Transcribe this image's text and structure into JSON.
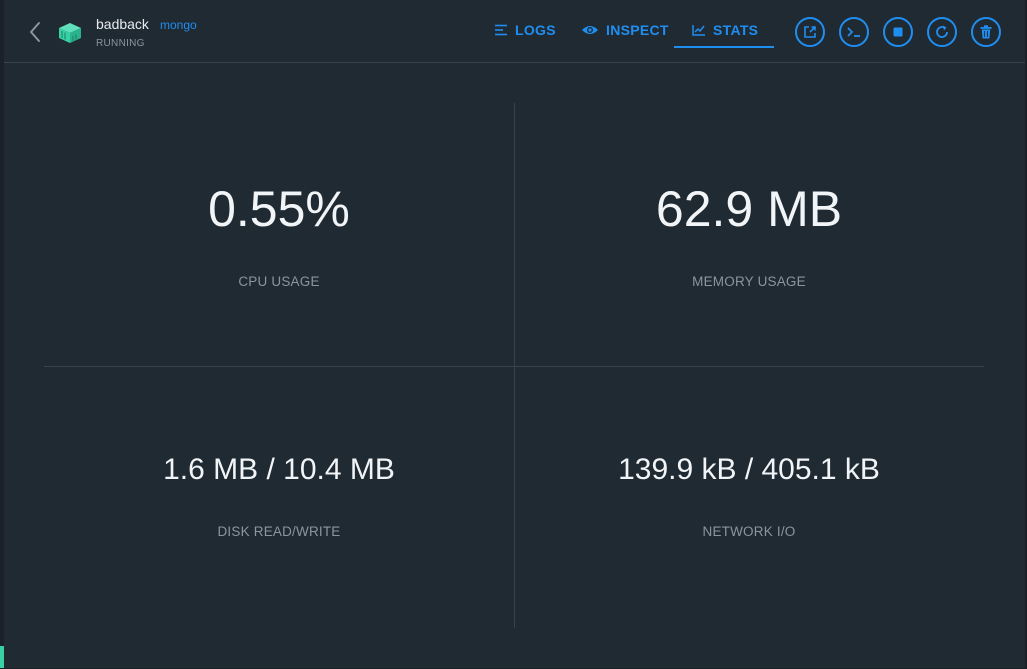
{
  "header": {
    "container_name": "badback",
    "image_name": "mongo",
    "status": "RUNNING"
  },
  "tabs": [
    {
      "label": "LOGS",
      "icon": "lines-icon"
    },
    {
      "label": "INSPECT",
      "icon": "eye-icon"
    },
    {
      "label": "STATS",
      "icon": "chart-icon",
      "active": true
    }
  ],
  "actions": [
    {
      "name": "open-in-browser-button",
      "icon": "open-external-icon"
    },
    {
      "name": "exec-shell-button",
      "icon": "terminal-icon"
    },
    {
      "name": "stop-button",
      "icon": "stop-icon"
    },
    {
      "name": "restart-button",
      "icon": "restart-icon"
    },
    {
      "name": "delete-button",
      "icon": "trash-icon"
    }
  ],
  "stats": {
    "cpu": {
      "value": "0.55%",
      "label": "CPU USAGE"
    },
    "memory": {
      "value": "62.9 MB",
      "label": "MEMORY USAGE"
    },
    "disk": {
      "value": "1.6 MB / 10.4 MB",
      "label": "DISK READ/WRITE"
    },
    "network": {
      "value": "139.9 kB / 405.1 kB",
      "label": "NETWORK I/O"
    }
  },
  "colors": {
    "background": "#202a33",
    "accent": "#1f8ef1",
    "container_icon": "#37d1a5",
    "divider": "#36424d",
    "muted_text": "#8a969f"
  }
}
